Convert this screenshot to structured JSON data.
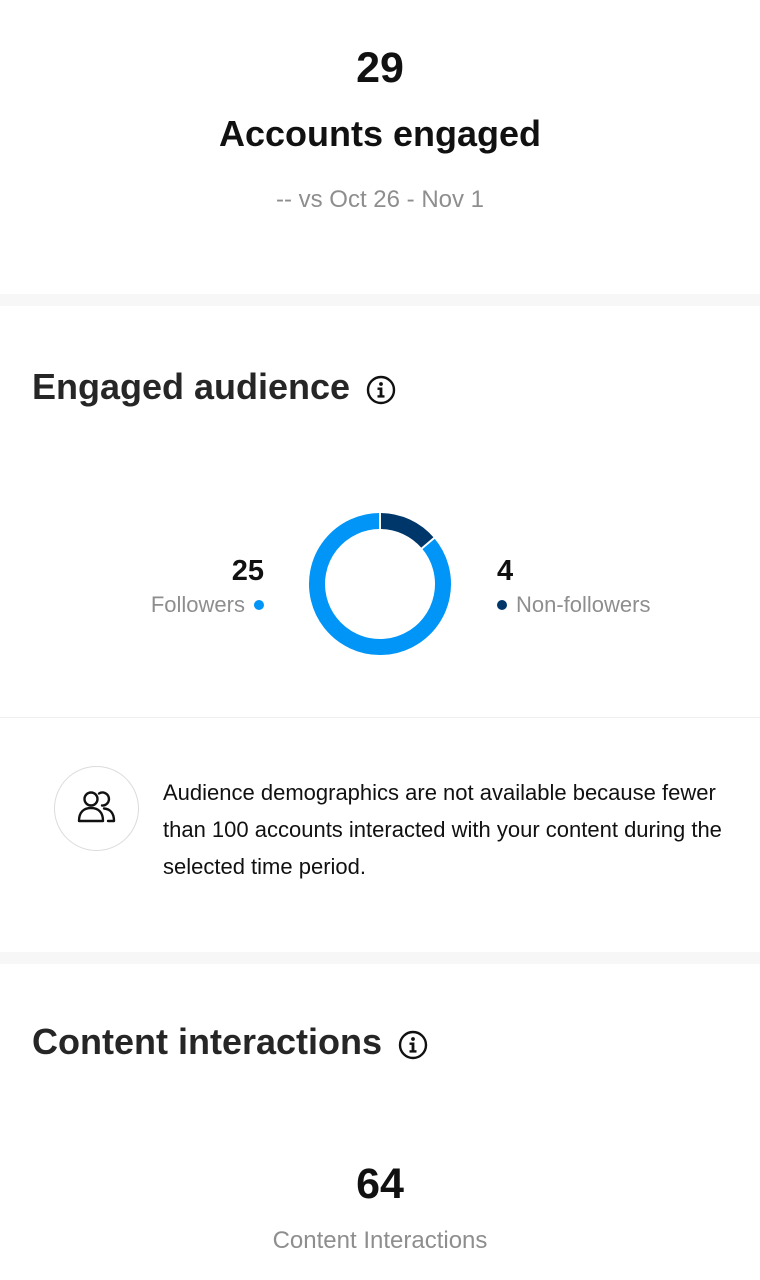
{
  "summary": {
    "value": "29",
    "label": "Accounts engaged",
    "comparison": "-- vs Oct 26 - Nov 1"
  },
  "engaged_audience": {
    "title": "Engaged audience",
    "info_icon": "info-icon",
    "followers": {
      "value": "25",
      "label": "Followers",
      "color": "#0095f6"
    },
    "non_followers": {
      "value": "4",
      "label": "Non-followers",
      "color": "#00376b"
    },
    "demographics_icon": "people-icon",
    "demographics_note": "Audience demographics are not available because fewer than 100 accounts interacted with your content during the selected time period."
  },
  "content_interactions": {
    "title": "Content interactions",
    "info_icon": "info-icon",
    "value": "64",
    "label": "Content Interactions"
  },
  "colors": {
    "followers": "#0095f6",
    "non_followers": "#00376b",
    "separator": "#f7f7f7",
    "muted_text": "#8e8e8e"
  }
}
